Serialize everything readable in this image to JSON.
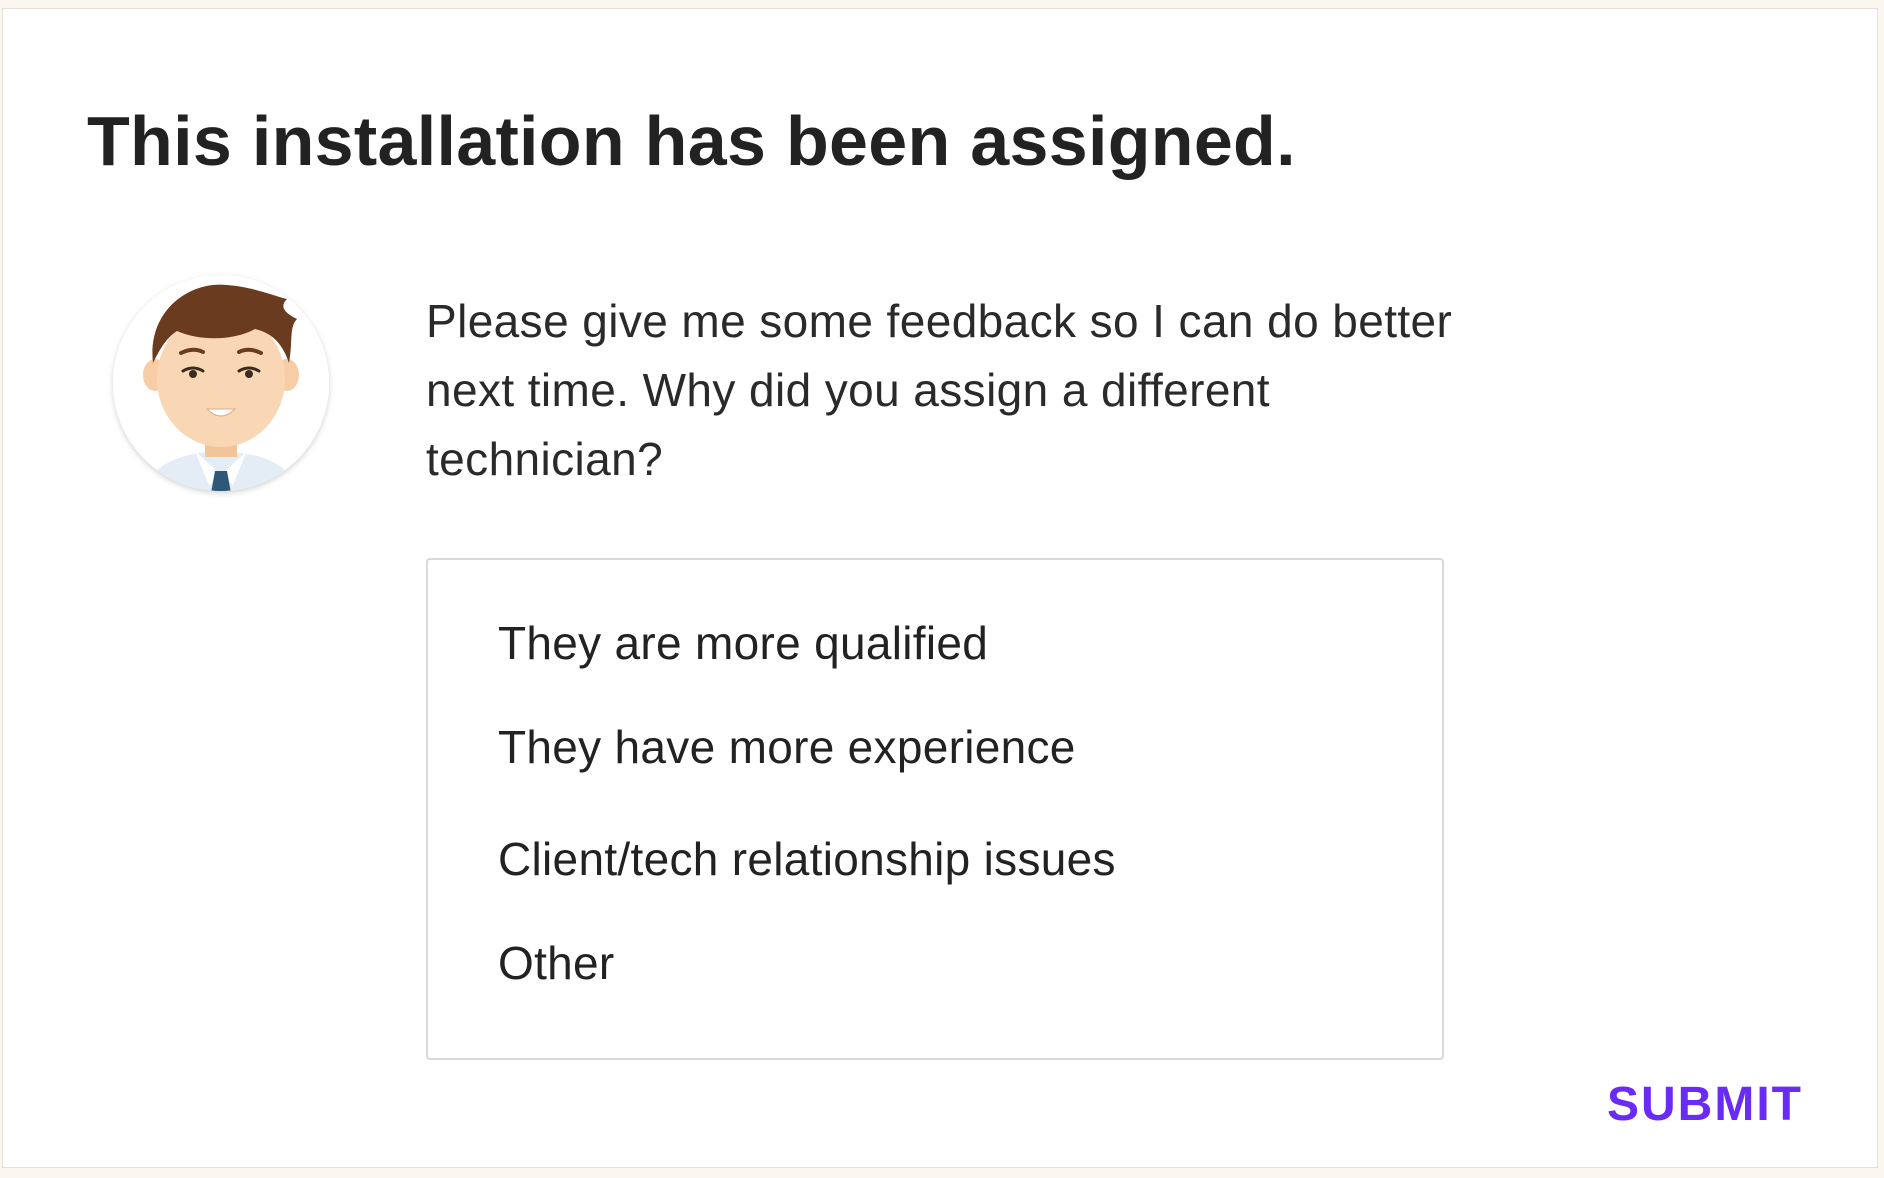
{
  "dialog": {
    "title": "This installation has been assigned.",
    "message": "Please give me some feedback so I can do better next time. Why did you assign a different technician?",
    "avatar_icon": "technician-avatar-icon",
    "options": [
      "They are more qualified",
      "They have more experience",
      "Client/tech relationship issues",
      "Other"
    ],
    "submit_label": "SUBMIT"
  },
  "colors": {
    "accent": "#6a2cf5",
    "text": "#222222",
    "page_background": "#fbf6ef",
    "card_background": "#ffffff",
    "border": "#d9d9d9"
  }
}
